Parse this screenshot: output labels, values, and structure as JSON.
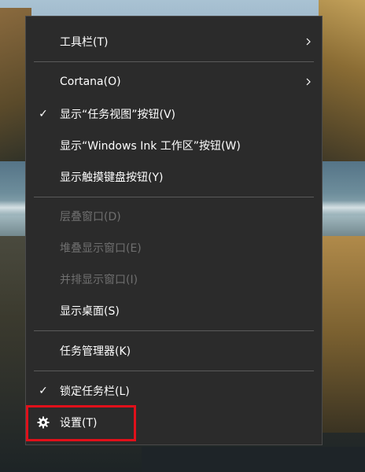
{
  "menu": {
    "items": [
      {
        "label": "工具栏(T)",
        "checked": false,
        "disabled": false,
        "submenu": true
      },
      {
        "label": "Cortana(O)",
        "checked": false,
        "disabled": false,
        "submenu": true
      },
      {
        "label": "显示“任务视图”按钮(V)",
        "checked": true,
        "disabled": false,
        "submenu": false
      },
      {
        "label": "显示“Windows Ink 工作区”按钮(W)",
        "checked": false,
        "disabled": false,
        "submenu": false
      },
      {
        "label": "显示触摸键盘按钮(Y)",
        "checked": false,
        "disabled": false,
        "submenu": false
      },
      {
        "label": "层叠窗口(D)",
        "checked": false,
        "disabled": true,
        "submenu": false
      },
      {
        "label": "堆叠显示窗口(E)",
        "checked": false,
        "disabled": true,
        "submenu": false
      },
      {
        "label": "并排显示窗口(I)",
        "checked": false,
        "disabled": true,
        "submenu": false
      },
      {
        "label": "显示桌面(S)",
        "checked": false,
        "disabled": false,
        "submenu": false
      },
      {
        "label": "任务管理器(K)",
        "checked": false,
        "disabled": false,
        "submenu": false
      },
      {
        "label": "锁定任务栏(L)",
        "checked": true,
        "disabled": false,
        "submenu": false
      },
      {
        "label": "设置(T)",
        "checked": false,
        "disabled": false,
        "submenu": false,
        "icon": "gear-icon"
      }
    ],
    "check_glyph": "✓",
    "highlight_color": "#e0101a",
    "disabled_color": "#6f6f6f"
  }
}
